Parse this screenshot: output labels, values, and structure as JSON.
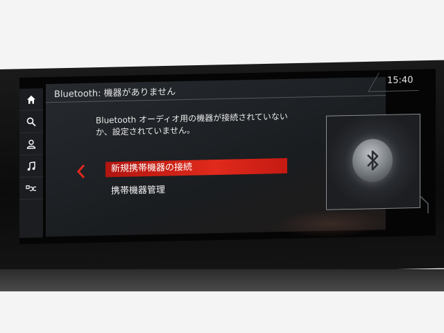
{
  "header": {
    "title": "Bluetooth: 機器がありません"
  },
  "clock": {
    "time": "15:40"
  },
  "message": {
    "text": "Bluetooth オーディオ用の機器が接続されていないか、設定されていません。"
  },
  "menu": {
    "items": [
      {
        "label": "新規携帯機器の接続",
        "selected": true
      },
      {
        "label": "携帯機器管理",
        "selected": false
      }
    ]
  },
  "sidebar": {
    "icons": [
      "home-icon",
      "search-icon",
      "contacts-icon",
      "music-icon",
      "shuffle-connect-icon"
    ]
  },
  "colors": {
    "accent": "#e02a1c",
    "text": "#e8e8e8",
    "panel": "#1f2226"
  }
}
